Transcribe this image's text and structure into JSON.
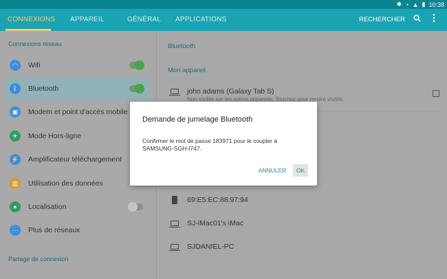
{
  "statusbar": {
    "bluetooth_icon": "bluetooth-icon",
    "wifi_icon": "wifi-icon",
    "signal_icon": "signal-icon",
    "battery_icon": "battery-icon",
    "time": "10:38"
  },
  "tabs": [
    {
      "label": "CONNEXIONS"
    },
    {
      "label": "APPAREIL"
    },
    {
      "label": "GÉNÉRAL"
    },
    {
      "label": "APPLICATIONS"
    }
  ],
  "appbar": {
    "search_label": "RECHERCHER",
    "search_icon": "search-icon",
    "more_icon": "more-vert-icon"
  },
  "sidebar": {
    "section1": "Connexions réseau",
    "items": [
      {
        "label": "Wifi",
        "icon": "wifi-icon",
        "color": "#3a8ede",
        "toggle": "on"
      },
      {
        "label": "Bluetooth",
        "icon": "bluetooth-icon",
        "color": "#3a8ede",
        "toggle": "on"
      },
      {
        "label": "Modem et point d'accès mobile",
        "icon": "hotspot-icon",
        "color": "#3a8ede"
      },
      {
        "label": "Mode Hors-ligne",
        "icon": "airplane-icon",
        "color": "#2e9e5a"
      },
      {
        "label": "Amplificateur téléchargement",
        "icon": "download-booster-icon",
        "color": "#3a8ede"
      },
      {
        "label": "Utilisation des données",
        "icon": "data-usage-icon",
        "color": "#d99a2b"
      },
      {
        "label": "Localisation",
        "icon": "location-icon",
        "color": "#2e9e5a",
        "toggle": "off"
      },
      {
        "label": "Plus de réseaux",
        "icon": "more-networks-icon",
        "color": "#3a8ede"
      }
    ],
    "section2": "Partage de connexion"
  },
  "right": {
    "title": "Bluetooth",
    "my_device_header": "Mon appareil",
    "my_device": {
      "name": "john adams (Galaxy Tab S)",
      "sub": "Non visible sur les autres appareils. Touchez pour rendre visible."
    },
    "devices": [
      {
        "name": "69:E5:EC:88:97:94",
        "icon": "phone-icon"
      },
      {
        "name": "SJ-iMac01's iMac",
        "icon": "laptop-icon"
      },
      {
        "name": "SJDANIEL-PC",
        "icon": "laptop-icon"
      }
    ]
  },
  "dialog": {
    "title": "Demande de jumelage Bluetooth",
    "message": "Confirmer le mot de passe 183971 pour le coupler à SAMSUNG-SGH-I747.",
    "cancel_label": "ANNULER",
    "ok_label": "OK"
  }
}
